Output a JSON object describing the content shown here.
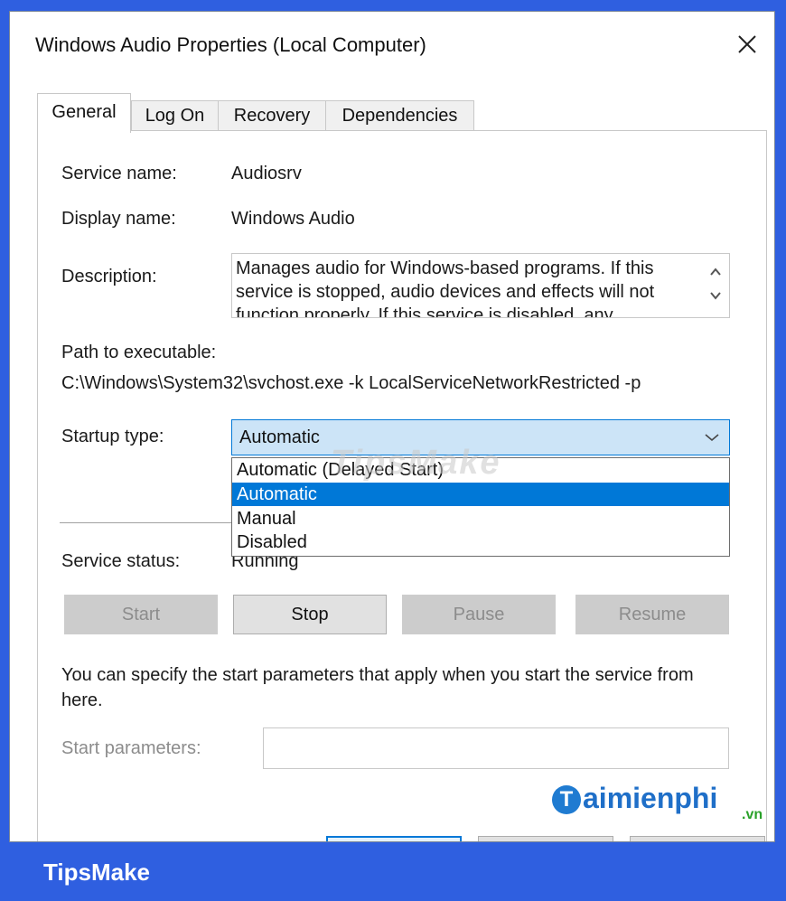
{
  "window": {
    "title": "Windows Audio Properties (Local Computer)"
  },
  "tabs": [
    {
      "label": "General",
      "active": true
    },
    {
      "label": "Log On",
      "active": false
    },
    {
      "label": "Recovery",
      "active": false
    },
    {
      "label": "Dependencies",
      "active": false
    }
  ],
  "general": {
    "service_name_label": "Service name:",
    "service_name": "Audiosrv",
    "display_name_label": "Display name:",
    "display_name": "Windows Audio",
    "description_label": "Description:",
    "description": "Manages audio for Windows-based programs.  If this service is stopped, audio devices and effects will not function properly.  If this service is disabled, any",
    "path_label": "Path to executable:",
    "path": "C:\\Windows\\System32\\svchost.exe -k LocalServiceNetworkRestricted -p",
    "startup_label": "Startup type:",
    "startup_value": "Automatic",
    "startup_options": [
      "Automatic (Delayed Start)",
      "Automatic",
      "Manual",
      "Disabled"
    ],
    "status_label": "Service status:",
    "status_value": "Running",
    "buttons": {
      "start": "Start",
      "stop": "Stop",
      "pause": "Pause",
      "resume": "Resume"
    },
    "hint": "You can specify the start parameters that apply when you start the service from here.",
    "params_label": "Start parameters:",
    "params_value": ""
  },
  "watermark": "TipsMake",
  "logo": {
    "initial": "T",
    "word": "aimienphi",
    "suffix": ".vn"
  },
  "footer": {
    "brand": "TipsMake"
  },
  "colors": {
    "accent": "#0078d7",
    "frame": "#2f5fe0",
    "combo_bg": "#cce4f7"
  }
}
